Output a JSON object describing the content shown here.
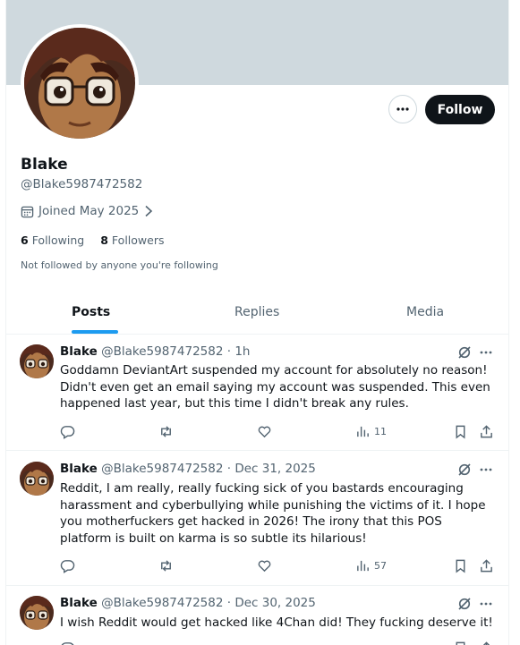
{
  "profile": {
    "display_name": "Blake",
    "handle": "@Blake5987472582",
    "joined": "Joined May 2025",
    "following_count": "6",
    "following_label": "Following",
    "followers_count": "8",
    "followers_label": "Followers",
    "not_followed_text": "Not followed by anyone you're following"
  },
  "buttons": {
    "follow": "Follow"
  },
  "tabs": [
    {
      "label": "Posts",
      "active": true
    },
    {
      "label": "Replies",
      "active": false
    },
    {
      "label": "Media",
      "active": false
    }
  ],
  "posts": [
    {
      "name": "Blake",
      "handle": "@Blake5987472582",
      "time": "· 1h",
      "text": "Goddamn DeviantArt suspended my account for absolutely no reason! Didn't even get an email saying my account was suspended. This even happened last year, but this time I didn't break any rules.",
      "views": "11"
    },
    {
      "name": "Blake",
      "handle": "@Blake5987472582",
      "time": "· Dec 31, 2025",
      "text": "Reddit, I am really, really fucking sick of you bastards encouraging harassment and cyberbullying while punishing the victims of it. I hope you motherfuckers get hacked in 2026! The irony that this POS platform is built on karma is so subtle its hilarious!",
      "views": "57"
    },
    {
      "name": "Blake",
      "handle": "@Blake5987472582",
      "time": "· Dec 30, 2025",
      "text": "I wish Reddit would get hacked like 4Chan did! They fucking deserve it!",
      "views": ""
    }
  ],
  "colors": {
    "accent": "#1d9bf0",
    "banner": "#cfd9de",
    "secondary_text": "#536471",
    "primary_text": "#0f1419"
  },
  "icons": [
    "more-horizontal-icon",
    "calendar-icon",
    "chevron-right-icon",
    "grok-icon",
    "reply-icon",
    "repost-icon",
    "like-icon",
    "views-icon",
    "bookmark-icon",
    "share-icon"
  ]
}
